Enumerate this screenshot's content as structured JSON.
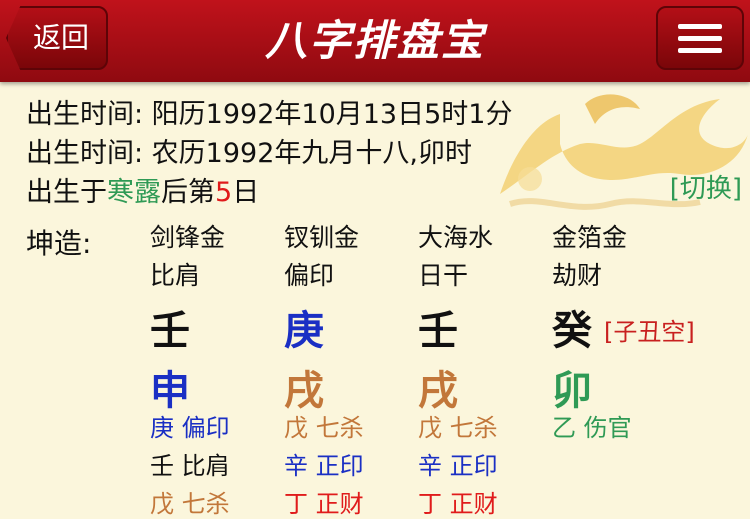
{
  "header": {
    "back_label": "返回",
    "title": "八字排盘宝"
  },
  "birth": {
    "solar": "出生时间: 阳历1992年10月13日5时1分",
    "lunar": "出生时间: 农历1992年九月十八,卯时",
    "term_prefix": "出生于",
    "term_name": "寒露",
    "term_mid": "后第",
    "term_day": "5",
    "term_suffix": "日",
    "switch_label": "[切换]"
  },
  "chart": {
    "label": "坤造:",
    "kong": "[子丑空]",
    "pillars": [
      {
        "nayin": "剑锋金",
        "god": "比肩",
        "stem": "壬",
        "stem_color": "#111111",
        "branch": "申",
        "branch_color": "#1a2fc4",
        "hidden": [
          {
            "text": "庚 偏印",
            "color": "#1a2fc4"
          },
          {
            "text": "壬 比肩",
            "color": "#111111"
          },
          {
            "text": "戊 七杀",
            "color": "#c2773a"
          }
        ]
      },
      {
        "nayin": "钗钏金",
        "god": "偏印",
        "stem": "庚",
        "stem_color": "#1a2fc4",
        "branch": "戌",
        "branch_color": "#c2773a",
        "hidden": [
          {
            "text": "戊 七杀",
            "color": "#c2773a"
          },
          {
            "text": "辛 正印",
            "color": "#1a2fc4"
          },
          {
            "text": "丁 正财",
            "color": "#e01b1b"
          }
        ]
      },
      {
        "nayin": "大海水",
        "god": "日干",
        "stem": "壬",
        "stem_color": "#111111",
        "branch": "戌",
        "branch_color": "#c2773a",
        "hidden": [
          {
            "text": "戊 七杀",
            "color": "#c2773a"
          },
          {
            "text": "辛 正印",
            "color": "#1a2fc4"
          },
          {
            "text": "丁 正财",
            "color": "#e01b1b"
          }
        ]
      },
      {
        "nayin": "金箔金",
        "god": "劫财",
        "stem": "癸",
        "stem_color": "#111111",
        "branch": "卯",
        "branch_color": "#2f9a55",
        "hidden": [
          {
            "text": "乙 伤官",
            "color": "#2f9a55"
          }
        ]
      }
    ]
  }
}
